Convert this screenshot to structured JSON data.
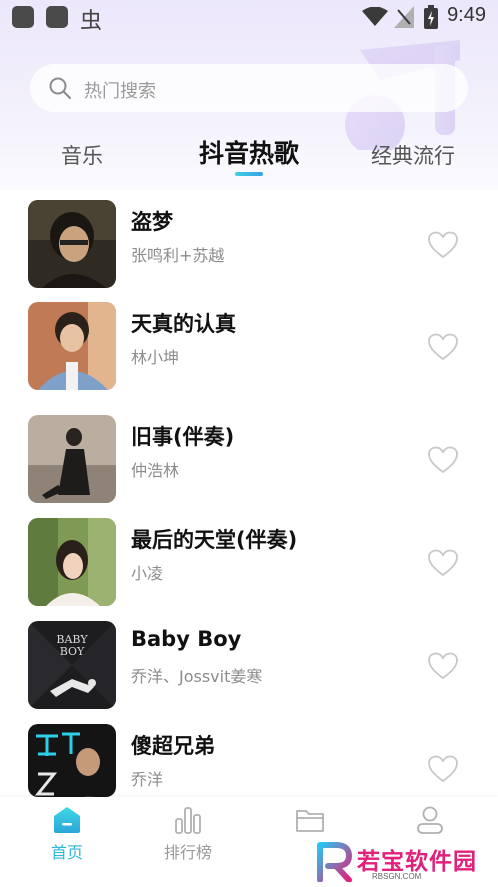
{
  "status_bar": {
    "left_glyph": "虫",
    "time": "9:49"
  },
  "search": {
    "placeholder": "热门搜索"
  },
  "tabs": [
    {
      "label": "音乐",
      "active": false
    },
    {
      "label": "抖音热歌",
      "active": true
    },
    {
      "label": "经典流行",
      "active": false
    }
  ],
  "songs": [
    {
      "title": "盗梦",
      "artist": "张鸣利+苏越"
    },
    {
      "title": "天真的认真",
      "artist": "林小坤"
    },
    {
      "title": "旧事(伴奏)",
      "artist": "仲浩林"
    },
    {
      "title": "最后的天堂(伴奏)",
      "artist": "小凌"
    },
    {
      "title": "Baby Boy",
      "artist": "乔洋、Jossvit姜寒"
    },
    {
      "title": "傻超兄弟",
      "artist": "乔洋"
    }
  ],
  "bottom_nav": [
    {
      "label": "首页",
      "icon": "home-icon",
      "active": true
    },
    {
      "label": "排行榜",
      "icon": "chart-bars-icon",
      "active": false
    },
    {
      "label": "",
      "icon": "folder-icon",
      "active": false
    },
    {
      "label": "",
      "icon": "user-icon",
      "active": false
    }
  ],
  "watermark": {
    "text": "若宝软件园",
    "sub": "RBSGN.COM"
  },
  "colors": {
    "accent": "#2db7d9",
    "top_background": "#ece7fb",
    "watermark": "#e0207a"
  }
}
